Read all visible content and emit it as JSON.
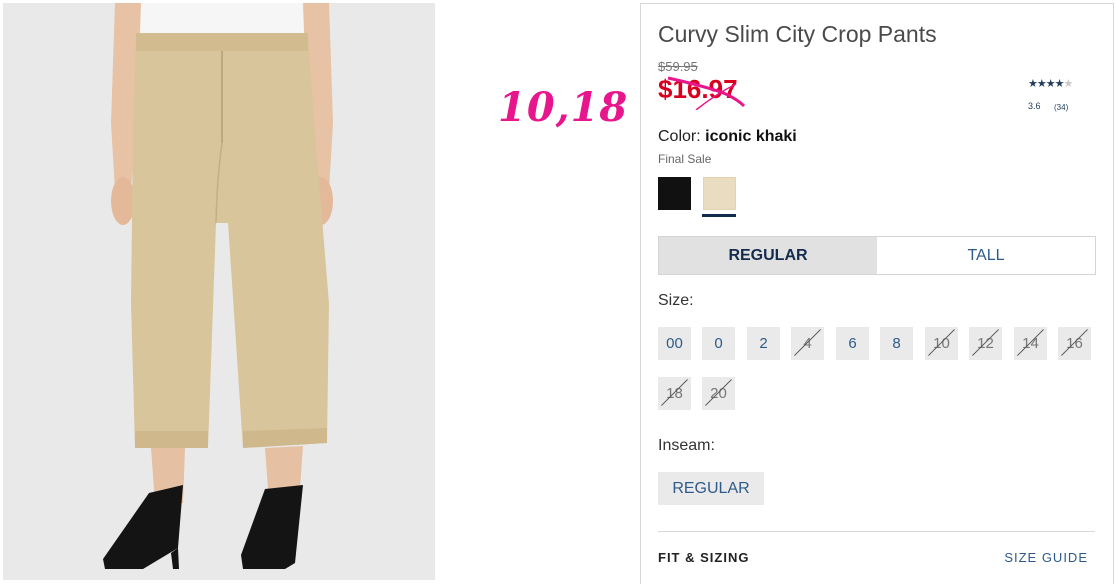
{
  "product": {
    "title": "Curvy Slim City Crop Pants",
    "original_price": "$59.95",
    "sale_price": "$16.97",
    "rating_value": "3.6",
    "rating_count": "(34)",
    "rating_stars": 3.6,
    "color_label": "Color:",
    "color_name": "iconic khaki",
    "final_sale": "Final Sale"
  },
  "overlay": {
    "handwritten_price": "10,18"
  },
  "swatches": [
    {
      "name": "black",
      "color": "#111111",
      "selected": false
    },
    {
      "name": "iconic khaki",
      "color": "#e9dcc0",
      "selected": true
    }
  ],
  "fit_tabs": [
    {
      "label": "REGULAR",
      "active": true
    },
    {
      "label": "TALL",
      "active": false
    }
  ],
  "size": {
    "label": "Size:",
    "options": [
      {
        "label": "00",
        "available": true
      },
      {
        "label": "0",
        "available": true
      },
      {
        "label": "2",
        "available": true
      },
      {
        "label": "4",
        "available": false
      },
      {
        "label": "6",
        "available": true
      },
      {
        "label": "8",
        "available": true
      },
      {
        "label": "10",
        "available": false
      },
      {
        "label": "12",
        "available": false
      },
      {
        "label": "14",
        "available": false
      },
      {
        "label": "16",
        "available": false
      },
      {
        "label": "18",
        "available": false
      },
      {
        "label": "20",
        "available": false
      }
    ]
  },
  "inseam": {
    "label": "Inseam:",
    "option": "REGULAR"
  },
  "details": {
    "fit_sizing": "FIT & SIZING",
    "size_guide": "SIZE GUIDE"
  },
  "colors": {
    "sale_red": "#d8001e",
    "link_blue": "#2f5b8a",
    "navy": "#132c4e",
    "overlay_pink": "#e8168c"
  }
}
